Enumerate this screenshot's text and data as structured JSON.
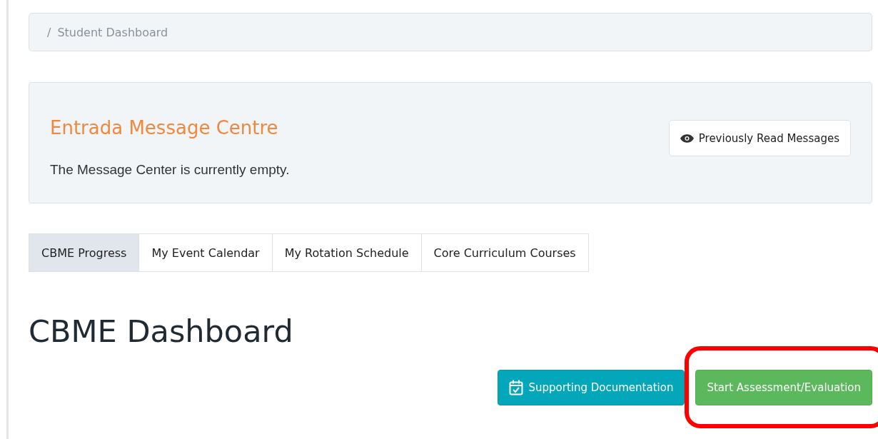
{
  "breadcrumb": {
    "separator": "/",
    "current": "Student Dashboard"
  },
  "message_centre": {
    "title": "Entrada Message Centre",
    "message": "The Message Center is currently empty.",
    "button": "Previously Read Messages"
  },
  "tabs": [
    {
      "label": "CBME Progress",
      "selected": true
    },
    {
      "label": "My Event Calendar",
      "selected": false
    },
    {
      "label": "My Rotation Schedule",
      "selected": false
    },
    {
      "label": "Core Curriculum Courses",
      "selected": false
    }
  ],
  "heading": "CBME Dashboard",
  "actions": [
    {
      "label": "Supporting Documentation",
      "kind": "info",
      "highlighted": false
    },
    {
      "label": "Start Assessment/Evaluation",
      "kind": "success",
      "highlighted": true
    }
  ]
}
